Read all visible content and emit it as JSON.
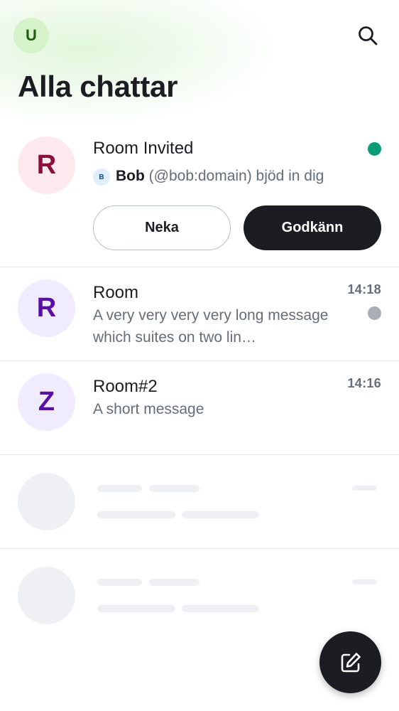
{
  "header": {
    "user_avatar_letter": "U",
    "title": "Alla chattar",
    "search_icon": "search-icon"
  },
  "invite": {
    "avatar_letter": "R",
    "room_name": "Room Invited",
    "inviter_badge": "B",
    "inviter_name": "Bob",
    "inviter_rest": " (@bob:domain) bjöd in dig",
    "decline_label": "Neka",
    "accept_label": "Godkänn",
    "status_dot_color": "#0a9c77"
  },
  "rooms": [
    {
      "avatar_letter": "R",
      "name": "Room",
      "time": "14:18",
      "message": "A very very very very long message which suites on two lin…",
      "unread_dot_color": "#a9aeb6"
    },
    {
      "avatar_letter": "Z",
      "name": "Room#2",
      "time": "14:16",
      "message": "A short message"
    }
  ],
  "fab": {
    "icon": "compose-icon"
  },
  "colors": {
    "accent_green_avatar_bg": "#d5f2c8",
    "invite_avatar_bg": "#fde8ee",
    "invite_avatar_fg": "#8a0f3a",
    "room_avatar_bg": "#f0ebff",
    "room_avatar_fg": "#5a0fa6",
    "text_primary": "#1b1d22",
    "text_secondary": "#656d77"
  }
}
